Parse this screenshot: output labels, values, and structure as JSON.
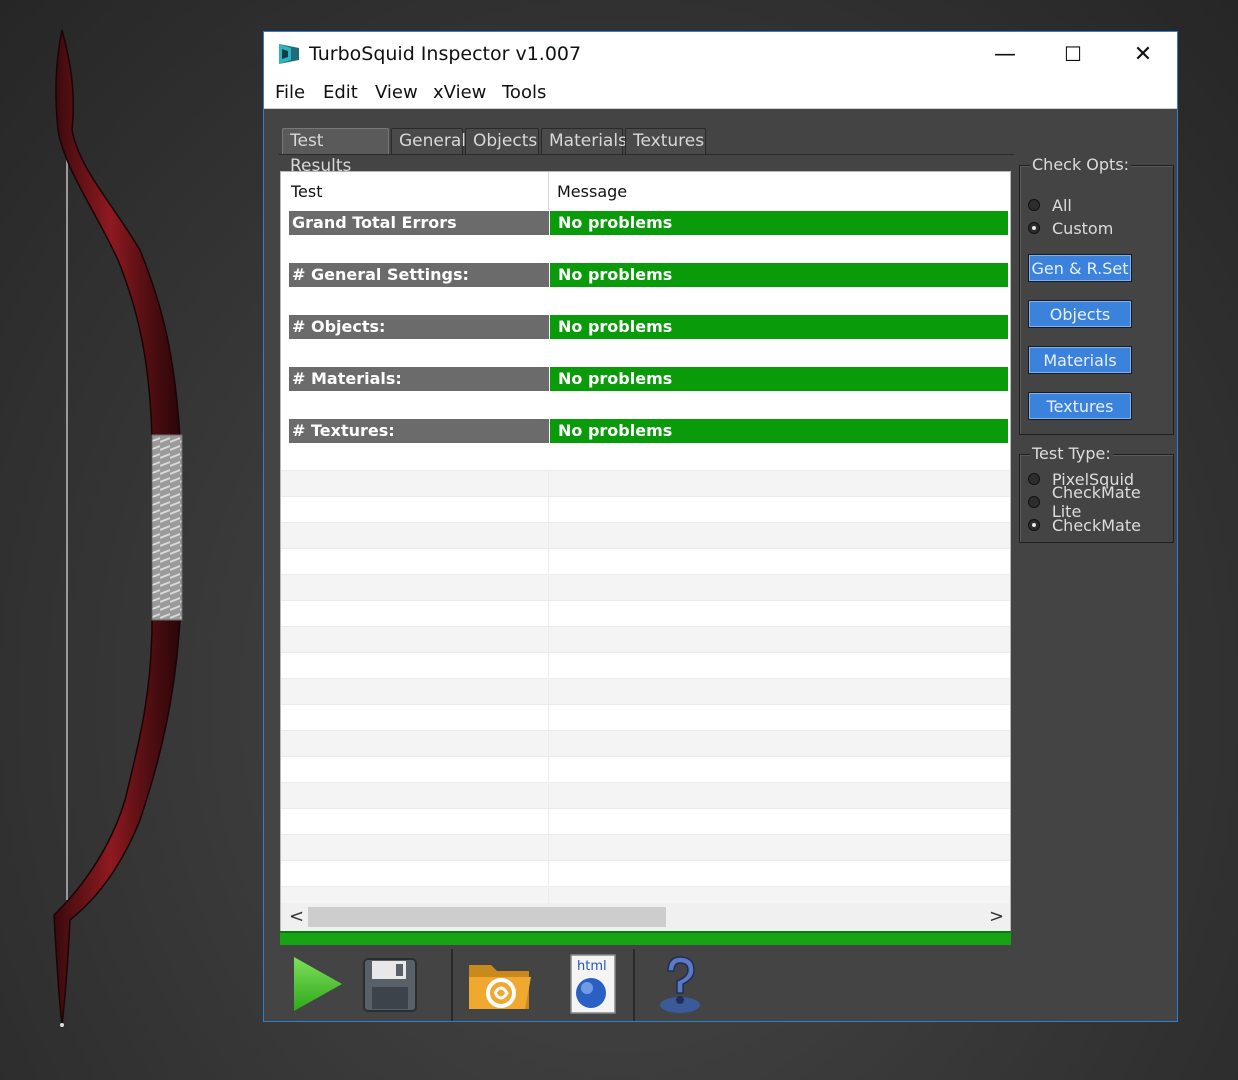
{
  "window": {
    "title": "TurboSquid Inspector v1.007",
    "controls": {
      "minimize": "—",
      "maximize": "☐",
      "close": "✕"
    }
  },
  "menu": [
    "File",
    "Edit",
    "View",
    "xView",
    "Tools"
  ],
  "tabs": [
    "Test Results",
    "General",
    "Objects",
    "Materials",
    "Textures"
  ],
  "active_tab": "Test Results",
  "table": {
    "columns": [
      "Test",
      "Message"
    ],
    "rows": [
      {
        "test": "Grand Total Errors",
        "message": "No problems"
      },
      {
        "test": "# General Settings:",
        "message": "No problems"
      },
      {
        "test": "# Objects:",
        "message": "No problems"
      },
      {
        "test": "# Materials:",
        "message": "No problems"
      },
      {
        "test": "# Textures:",
        "message": "No problems"
      }
    ],
    "scroll_left": "<",
    "scroll_right": ">"
  },
  "check_opts": {
    "label": "Check Opts:",
    "options": [
      "All",
      "Custom"
    ],
    "selected": "Custom",
    "buttons": [
      "Gen & R.Set",
      "Objects",
      "Materials",
      "Textures"
    ]
  },
  "test_type": {
    "label": "Test Type:",
    "options": [
      "PixelSquid",
      "CheckMate Lite",
      "CheckMate"
    ],
    "selected": "CheckMate"
  },
  "toolbar_icons": [
    "play-icon",
    "save-icon",
    "open-folder-icon",
    "html-export-icon",
    "help-icon"
  ],
  "colors": {
    "ok_green": "#0a9b0a",
    "error_label_bg": "#6b6b6b",
    "button_blue": "#3b82dc",
    "window_border": "#2f7fd0"
  }
}
